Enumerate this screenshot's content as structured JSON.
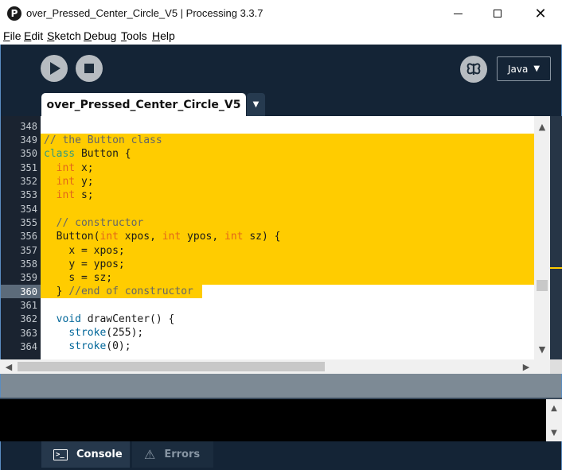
{
  "window": {
    "title": "over_Pressed_Center_Circle_V5 | Processing 3.3.7",
    "app_icon_glyph": "P",
    "close_glyph": "✕"
  },
  "menu": {
    "items": [
      {
        "label_u": "F",
        "label_rest": "ile"
      },
      {
        "label_u": "E",
        "label_rest": "dit"
      },
      {
        "label_u": "S",
        "label_rest": "ketch"
      },
      {
        "label_u": "D",
        "label_rest": "ebug"
      },
      {
        "label_u": "T",
        "label_rest": "ools"
      },
      {
        "label_u": "H",
        "label_rest": "elp"
      }
    ]
  },
  "toolbar": {
    "run_icon": "play-icon",
    "stop_icon": "stop-icon",
    "debug_icon": "butterfly-icon",
    "mode": "Java",
    "mode_caret": "▼"
  },
  "tabs": {
    "active": "over_Pressed_Center_Circle_V5",
    "menu_caret": "▼"
  },
  "editor": {
    "line_numbers": [
      "348",
      "349",
      "350",
      "351",
      "352",
      "353",
      "354",
      "355",
      "356",
      "357",
      "358",
      "359",
      "360",
      "361",
      "362",
      "363",
      "364"
    ],
    "current_line": "360",
    "code": {
      "l349": "// the Button class",
      "l350_kw": "class",
      "l350_rest": " Button {",
      "l351_type": "int",
      "l351_rest": " x;",
      "l352_type": "int",
      "l352_rest": " y;",
      "l353_type": "int",
      "l353_rest": " s;",
      "l355": "// constructor",
      "l356_a": "Button(",
      "l356_t1": "int",
      "l356_b": " xpos, ",
      "l356_t2": "int",
      "l356_c": " ypos, ",
      "l356_t3": "int",
      "l356_d": " sz) {",
      "l357": "x = xpos;",
      "l358": "y = ypos;",
      "l359": "s = sz;",
      "l360_a": "} ",
      "l360_comment": "//end of constructor",
      "l362_kw": "void",
      "l362_rest": " drawCenter() {",
      "l363_fn": "stroke",
      "l363_rest": "(255);",
      "l364_fn": "stroke",
      "l364_rest": "(0);"
    },
    "scroll_up": "▲",
    "scroll_down": "▼",
    "scroll_left": "◀",
    "scroll_right": "▶"
  },
  "colors": {
    "selection": "#ffcc00",
    "toolbar_bg": "#142436",
    "keyword_class": "#33997e",
    "keyword_type": "#e2661a",
    "function": "#006699",
    "comment": "#666666"
  },
  "footer": {
    "console_label": "Console",
    "errors_label": "Errors",
    "console_icon_text": ">_",
    "errors_icon": "⚠"
  }
}
